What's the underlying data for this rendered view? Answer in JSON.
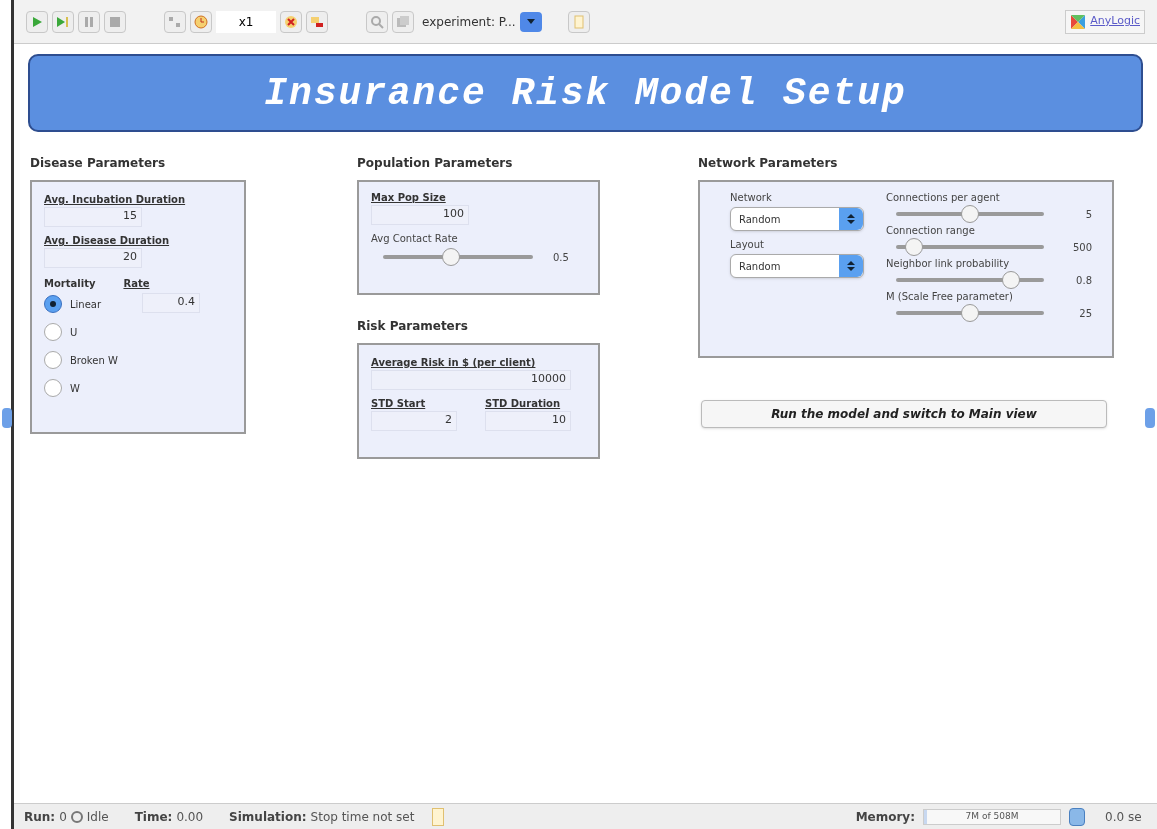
{
  "toolbar": {
    "speed": "x1",
    "experiment": "experiment: P...",
    "logo": "AnyLogic"
  },
  "title": "Insurance Risk Model Setup",
  "disease": {
    "heading": "Disease Parameters",
    "fields": [
      {
        "label": "Avg. Incubation Duration",
        "value": "15"
      },
      {
        "label": "Avg. Disease Duration",
        "value": "20"
      }
    ],
    "mortality_label": "Mortality",
    "rate_label": "Rate",
    "rate_value": "0.4",
    "options": [
      {
        "label": "Linear",
        "selected": true
      },
      {
        "label": "U",
        "selected": false
      },
      {
        "label": "Broken W",
        "selected": false
      },
      {
        "label": "W",
        "selected": false
      }
    ]
  },
  "population": {
    "heading": "Population Parameters",
    "field": {
      "label": "Max Pop Size",
      "value": "100"
    },
    "slider": {
      "label": "Avg Contact Rate",
      "level": 0.45,
      "reading": "0.5"
    }
  },
  "risk": {
    "heading": "Risk Parameters",
    "field": {
      "label": "Average Risk in $ (per client)",
      "value": "10000"
    },
    "fields": [
      {
        "label": "STD Start",
        "value": "2"
      },
      {
        "label": "STD Duration",
        "value": "10"
      }
    ]
  },
  "network": {
    "heading": "Network Parameters",
    "selects": [
      {
        "label": "Network",
        "value": "Random"
      },
      {
        "label": "Layout",
        "value": "Random"
      }
    ],
    "sliders": [
      {
        "label": "Connections per agent",
        "level": 0.5,
        "reading": "5"
      },
      {
        "label": "Connection range",
        "level": 0.12,
        "reading": "500"
      },
      {
        "label": "Neighbor link probability",
        "level": 0.78,
        "reading": "0.8"
      },
      {
        "label": "M (Scale Free parameter)",
        "level": 0.5,
        "reading": "25"
      }
    ]
  },
  "run_button": "Run the model and switch to Main view",
  "status_bar": {
    "run_label": "Run:",
    "run_value": "0",
    "state": "Idle",
    "time_label": "Time:",
    "time_value": "0.00",
    "sim_label": "Simulation:",
    "sim_value": "Stop time not set",
    "memory_label": "Memory:",
    "memory": {
      "value": "7M of 508M",
      "level": 0.02
    },
    "seconds": "0.0 se"
  }
}
